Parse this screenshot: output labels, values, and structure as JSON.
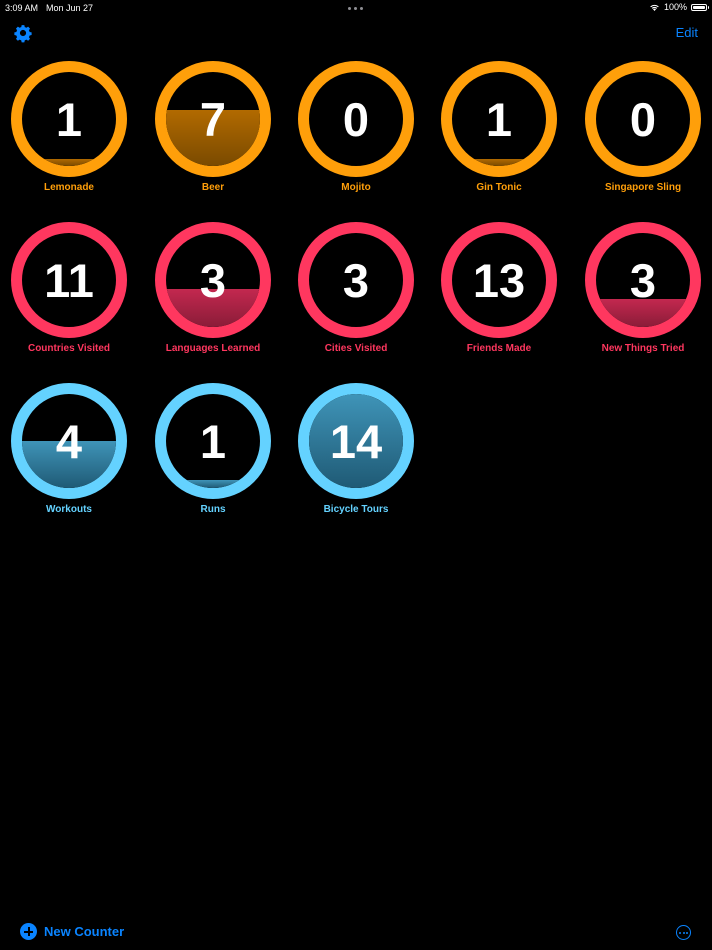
{
  "status_bar": {
    "time": "3:09 AM",
    "date": "Mon Jun 27",
    "battery": "100%"
  },
  "nav": {
    "edit_label": "Edit",
    "settings_icon": "gear-icon"
  },
  "colors": {
    "accent": "#0a84ff",
    "orange": "#ff9f0a",
    "pink": "#ff375f",
    "cyan": "#64d2ff"
  },
  "counters": [
    {
      "label": "Lemonade",
      "count": "1",
      "fill_fraction": 0.07,
      "color": "orange"
    },
    {
      "label": "Beer",
      "count": "7",
      "fill_fraction": 0.6,
      "color": "orange"
    },
    {
      "label": "Mojito",
      "count": "0",
      "fill_fraction": 0.0,
      "color": "orange"
    },
    {
      "label": "Gin Tonic",
      "count": "1",
      "fill_fraction": 0.07,
      "color": "orange"
    },
    {
      "label": "Singapore Sling",
      "count": "0",
      "fill_fraction": 0.0,
      "color": "orange"
    },
    {
      "label": "Countries Visited",
      "count": "11",
      "fill_fraction": 0.0,
      "color": "pink"
    },
    {
      "label": "Languages Learned",
      "count": "3",
      "fill_fraction": 0.4,
      "color": "pink"
    },
    {
      "label": "Cities Visited",
      "count": "3",
      "fill_fraction": 0.0,
      "color": "pink"
    },
    {
      "label": "Friends Made",
      "count": "13",
      "fill_fraction": 0.0,
      "color": "pink"
    },
    {
      "label": "New Things Tried",
      "count": "3",
      "fill_fraction": 0.3,
      "color": "pink"
    },
    {
      "label": "Workouts",
      "count": "4",
      "fill_fraction": 0.5,
      "color": "cyan"
    },
    {
      "label": "Runs",
      "count": "1",
      "fill_fraction": 0.08,
      "color": "cyan"
    },
    {
      "label": "Bicycle Tours",
      "count": "14",
      "fill_fraction": 1.0,
      "color": "cyan"
    }
  ],
  "bottom_bar": {
    "new_counter_label": "New Counter",
    "more_icon": "ellipsis-circle-icon"
  }
}
